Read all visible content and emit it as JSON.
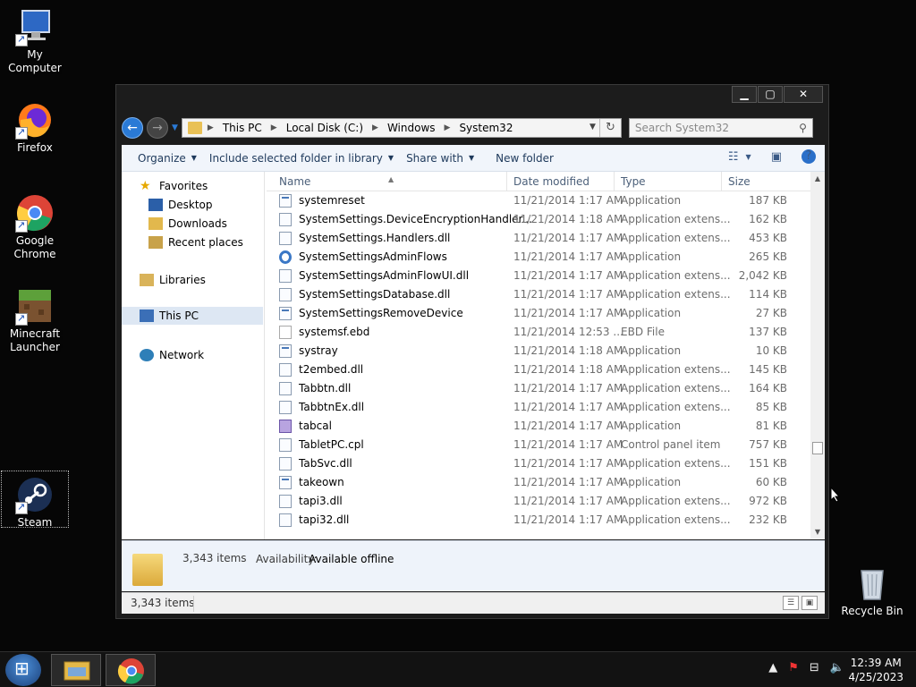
{
  "desktop": {
    "icons": [
      {
        "label": "My Computer"
      },
      {
        "label": "Firefox"
      },
      {
        "label": "Google Chrome"
      },
      {
        "label": "Minecraft Launcher"
      },
      {
        "label": "Steam"
      },
      {
        "label": "Recycle Bin"
      }
    ]
  },
  "window": {
    "controls": {
      "minimize": "▁",
      "maximize": "▢",
      "close": "✕"
    },
    "breadcrumb": [
      "This PC",
      "Local Disk (C:)",
      "Windows",
      "System32"
    ],
    "search_placeholder": "Search System32",
    "toolbar": {
      "organize": "Organize",
      "include": "Include selected folder in library",
      "share": "Share with",
      "new_folder": "New folder"
    },
    "nav": {
      "favorites": "Favorites",
      "desktop": "Desktop",
      "downloads": "Downloads",
      "recent": "Recent places",
      "libraries": "Libraries",
      "this_pc": "This PC",
      "network": "Network"
    },
    "columns": {
      "name": "Name",
      "date": "Date modified",
      "type": "Type",
      "size": "Size"
    },
    "files": [
      {
        "name": "systemreset",
        "date": "11/21/2014 1:17 AM",
        "type": "Application",
        "size": "187 KB",
        "icon": "app"
      },
      {
        "name": "SystemSettings.DeviceEncryptionHandler...",
        "date": "11/21/2014 1:18 AM",
        "type": "Application extens...",
        "size": "162 KB",
        "icon": "dll"
      },
      {
        "name": "SystemSettings.Handlers.dll",
        "date": "11/21/2014 1:17 AM",
        "type": "Application extens...",
        "size": "453 KB",
        "icon": "dll"
      },
      {
        "name": "SystemSettingsAdminFlows",
        "date": "11/21/2014 1:17 AM",
        "type": "Application",
        "size": "265 KB",
        "icon": "gear"
      },
      {
        "name": "SystemSettingsAdminFlowUI.dll",
        "date": "11/21/2014 1:17 AM",
        "type": "Application extens...",
        "size": "2,042 KB",
        "icon": "dll"
      },
      {
        "name": "SystemSettingsDatabase.dll",
        "date": "11/21/2014 1:17 AM",
        "type": "Application extens...",
        "size": "114 KB",
        "icon": "dll"
      },
      {
        "name": "SystemSettingsRemoveDevice",
        "date": "11/21/2014 1:17 AM",
        "type": "Application",
        "size": "27 KB",
        "icon": "app"
      },
      {
        "name": "systemsf.ebd",
        "date": "11/21/2014 12:53 ...",
        "type": "EBD File",
        "size": "137 KB",
        "icon": "file"
      },
      {
        "name": "systray",
        "date": "11/21/2014 1:18 AM",
        "type": "Application",
        "size": "10 KB",
        "icon": "app"
      },
      {
        "name": "t2embed.dll",
        "date": "11/21/2014 1:18 AM",
        "type": "Application extens...",
        "size": "145 KB",
        "icon": "dll"
      },
      {
        "name": "Tabbtn.dll",
        "date": "11/21/2014 1:17 AM",
        "type": "Application extens...",
        "size": "164 KB",
        "icon": "dll"
      },
      {
        "name": "TabbtnEx.dll",
        "date": "11/21/2014 1:17 AM",
        "type": "Application extens...",
        "size": "85 KB",
        "icon": "dll"
      },
      {
        "name": "tabcal",
        "date": "11/21/2014 1:17 AM",
        "type": "Application",
        "size": "81 KB",
        "icon": "tab"
      },
      {
        "name": "TabletPC.cpl",
        "date": "11/21/2014 1:17 AM",
        "type": "Control panel item",
        "size": "757 KB",
        "icon": "dll"
      },
      {
        "name": "TabSvc.dll",
        "date": "11/21/2014 1:17 AM",
        "type": "Application extens...",
        "size": "151 KB",
        "icon": "dll"
      },
      {
        "name": "takeown",
        "date": "11/21/2014 1:17 AM",
        "type": "Application",
        "size": "60 KB",
        "icon": "app"
      },
      {
        "name": "tapi3.dll",
        "date": "11/21/2014 1:17 AM",
        "type": "Application extens...",
        "size": "972 KB",
        "icon": "dll"
      },
      {
        "name": "tapi32.dll",
        "date": "11/21/2014 1:17 AM",
        "type": "Application extens...",
        "size": "232 KB",
        "icon": "dll"
      }
    ],
    "details": {
      "count": "3,343 items",
      "availability_label": "Availability:",
      "availability_value": "Available offline"
    },
    "status": "3,343 items"
  },
  "taskbar": {
    "time": "12:39 AM",
    "date": "4/25/2023"
  }
}
